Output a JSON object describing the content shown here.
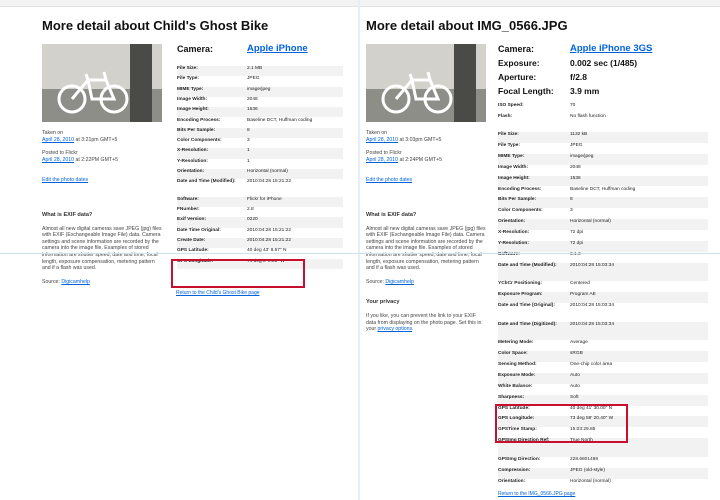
{
  "left": {
    "title": "More detail about Child's Ghost Bike",
    "camera_label": "Camera:",
    "camera_value": "Apple iPhone",
    "taken_on_label": "Taken on",
    "taken_on_date": "April 28, 2010",
    "taken_on_time": "at 3:21pm GMT+5",
    "posted_label": "Posted to Flickr",
    "posted_date": "April 28, 2010",
    "posted_time": "at 2:22PM GMT+5",
    "edit_dates": "Edit the photo dates",
    "exif_heading": "What is EXIF data?",
    "exif_text": "Almost all new digital cameras save JPEG (jpg) files with EXIF (Exchangeable Image File) data. Camera settings and scene information are recorded by the camera into the image file. Examples of stored information are shutter speed, date and time, focal length, exposure compensation, metering pattern and if a flash was used.",
    "source_label": "Source:",
    "source_link": "Digicamhelp",
    "rows": [
      {
        "k": "File Size:",
        "v": "2.1 MB"
      },
      {
        "k": "File Type:",
        "v": "JPEG"
      },
      {
        "k": "MIME Type:",
        "v": "image/jpeg"
      },
      {
        "k": "Image Width:",
        "v": "2048"
      },
      {
        "k": "Image Height:",
        "v": "1536"
      },
      {
        "k": "Encoding Process:",
        "v": "Baseline DCT, Huffman coding"
      },
      {
        "k": "Bits Per Sample:",
        "v": "8"
      },
      {
        "k": "Color Components:",
        "v": "3"
      },
      {
        "k": "X-Resolution:",
        "v": "1"
      },
      {
        "k": "Y-Resolution:",
        "v": "1"
      },
      {
        "k": "Orientation:",
        "v": "Horizontal (normal)"
      },
      {
        "k": "Date and Time (Modified):",
        "v": "2010:04:28 15:21:22"
      },
      {
        "k": "Software:",
        "v": "Flickr for iPhone"
      },
      {
        "k": "FNumber:",
        "v": "2.8"
      },
      {
        "k": "Exif Version:",
        "v": "0220"
      },
      {
        "k": "Date Time Original:",
        "v": "2010:04:28 15:21:22"
      },
      {
        "k": "Create Date:",
        "v": "2010:04:28 15:21:22"
      },
      {
        "k": "GPS Latitude:",
        "v": "40 deg 43' 8.57\" N"
      },
      {
        "k": "GPS Longitude:",
        "v": "74 deg 0' 0.83\" W"
      }
    ],
    "return_link": "Return to the Child's Ghost Bike page"
  },
  "right": {
    "title": "More detail about IMG_0566.JPG",
    "camera_label": "Camera:",
    "camera_value": "Apple iPhone 3GS",
    "exposure_label": "Exposure:",
    "exposure_value": "0.002 sec (1/485)",
    "aperture_label": "Aperture:",
    "aperture_value": "f/2.8",
    "focal_label": "Focal Length:",
    "focal_value": "3.9 mm",
    "iso_label": "ISO Speed:",
    "iso_value": "70",
    "flash_label": "Flash:",
    "flash_value": "No flash function",
    "taken_on_label": "Taken on",
    "taken_on_date": "April 28, 2010",
    "taken_on_time": "at 3:03pm GMT+5",
    "posted_label": "Posted to Flickr",
    "posted_date": "April 28, 2010",
    "posted_time": "at 2:24PM GMT+5",
    "edit_dates": "Edit the photo dates",
    "exif_heading": "What is EXIF data?",
    "exif_text": "Almost all new digital cameras save JPEG (jpg) files with EXIF (Exchangeable Image File) data. Camera settings and scene information are recorded by the camera into the image file. Examples of stored information are shutter speed, date and time, focal length, exposure compensation, metering pattern and if a flash was used.",
    "source_label": "Source:",
    "source_link": "Digicamhelp",
    "privacy_heading": "Your privacy",
    "privacy_text": "If you like, you can prevent the link to your EXIF data from displaying on the photo page. Set this in your",
    "privacy_link": "privacy options",
    "rows": [
      {
        "k": "File Size:",
        "v": "1132 kB"
      },
      {
        "k": "File Type:",
        "v": "JPEG"
      },
      {
        "k": "MIME Type:",
        "v": "image/jpeg"
      },
      {
        "k": "Image Width:",
        "v": "2048"
      },
      {
        "k": "Image Height:",
        "v": "1536"
      },
      {
        "k": "Encoding Process:",
        "v": "Baseline DCT, Huffman coding"
      },
      {
        "k": "Bits Per Sample:",
        "v": "8"
      },
      {
        "k": "Color Components:",
        "v": "3"
      },
      {
        "k": "Orientation:",
        "v": "Horizontal (normal)"
      },
      {
        "k": "X-Resolution:",
        "v": "72 dpi"
      },
      {
        "k": "Y-Resolution:",
        "v": "72 dpi"
      },
      {
        "k": "Software:",
        "v": "3.1.3"
      },
      {
        "k": "Date and Time (Modified):",
        "v": "2010:04:28 15:03:34"
      },
      {
        "k": "YCbCr Positioning:",
        "v": "Centered"
      },
      {
        "k": "Exposure Program:",
        "v": "Program AE"
      },
      {
        "k": "Date and Time (Original):",
        "v": "2010:04:28 15:03:34"
      },
      {
        "k": "Date and Time (Digitized):",
        "v": "2010:04:28 15:03:34"
      },
      {
        "k": "Metering Mode:",
        "v": "Average"
      },
      {
        "k": "Color Space:",
        "v": "sRGB"
      },
      {
        "k": "Sensing Method:",
        "v": "One-chip color area"
      },
      {
        "k": "Exposure Mode:",
        "v": "Auto"
      },
      {
        "k": "White Balance:",
        "v": "Auto"
      },
      {
        "k": "Sharpness:",
        "v": "Soft"
      },
      {
        "k": "GPS Latitude:",
        "v": "40 deg 41' 30.00\" N"
      },
      {
        "k": "GPS Longitude:",
        "v": "73 deg 59' 20.40\" W"
      },
      {
        "k": "GPSTime Stamp:",
        "v": "15:03:29.85"
      },
      {
        "k": "GPSImg Direction Ref:",
        "v": "True North"
      },
      {
        "k": "GPSImg Direction:",
        "v": "228.6801498"
      },
      {
        "k": "Compression:",
        "v": "JPEG (old-style)"
      },
      {
        "k": "Orientation:",
        "v": "Horizontal (normal)"
      }
    ],
    "return_link": "Return to the IMG_0566.JPG page"
  },
  "colors": {
    "link": "#0063dc",
    "highlight": "#c8102e",
    "row_shade": "#f2f2f2"
  }
}
